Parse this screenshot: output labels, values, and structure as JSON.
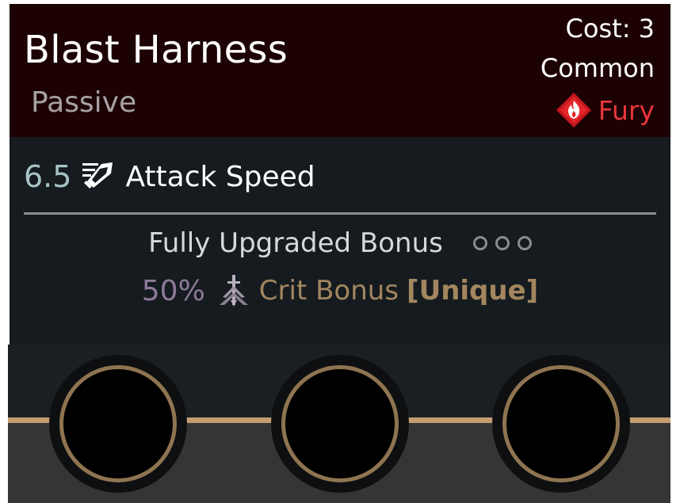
{
  "item": {
    "name": "Blast Harness",
    "type": "Passive",
    "cost": "Cost: 3",
    "rarity": "Common",
    "category": {
      "label": "Fury",
      "icon": "fury-icon",
      "color": "#e9363b"
    }
  },
  "stats": [
    {
      "value": "6.5",
      "icon": "attack-speed-icon",
      "label": "Attack Speed"
    }
  ],
  "upgrade_bonus": {
    "title": "Fully Upgraded Bonus",
    "pips_filled": 0,
    "pips_total": 3,
    "value": "50%",
    "icon": "crit-bonus-icon",
    "label": "Crit Bonus",
    "tag": "[Unique]"
  },
  "slots": {
    "count": 3,
    "filled": 0
  },
  "colors": {
    "header_bg": "#1d0204",
    "card_bg": "#151b1f",
    "accent_gold": "#c39c70",
    "fury_red": "#e9363b"
  }
}
